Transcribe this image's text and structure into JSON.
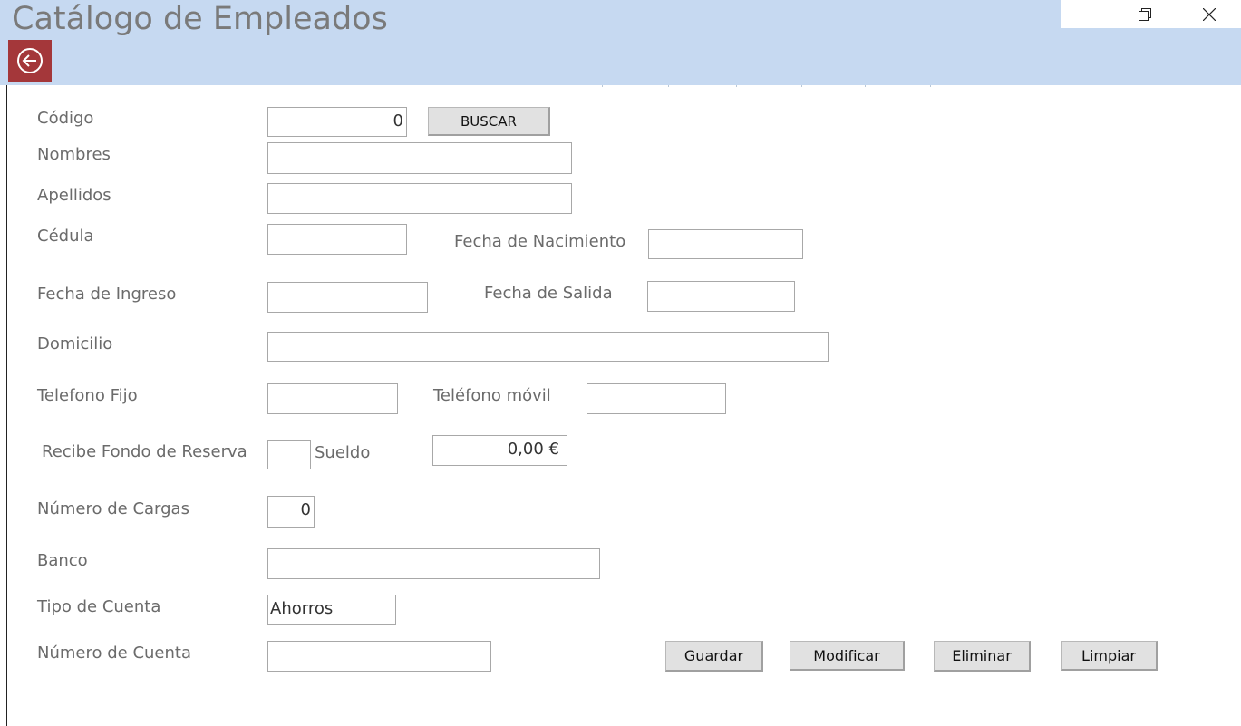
{
  "window": {
    "title": "Catálogo de Empleados",
    "controls": {
      "minimize_icon": "minimize-icon",
      "restore_icon": "restore-icon",
      "close_icon": "close-icon"
    },
    "colors": {
      "header_bg": "#c6d9f1",
      "back_button_bg": "#a4373a"
    }
  },
  "form": {
    "codigo": {
      "label": "Código",
      "value": "0",
      "search_button": "BUSCAR"
    },
    "nombres": {
      "label": "Nombres",
      "value": ""
    },
    "apellidos": {
      "label": "Apellidos",
      "value": ""
    },
    "cedula": {
      "label": "Cédula",
      "value": ""
    },
    "fecha_nacimiento": {
      "label": "Fecha de Nacimiento",
      "value": ""
    },
    "fecha_ingreso": {
      "label": "Fecha de Ingreso",
      "value": ""
    },
    "fecha_salida": {
      "label": "Fecha de Salida",
      "value": ""
    },
    "domicilio": {
      "label": "Domicilio",
      "value": ""
    },
    "telefono_fijo": {
      "label": "Telefono Fijo",
      "value": ""
    },
    "telefono_movil": {
      "label": "Teléfono móvil",
      "value": ""
    },
    "fondo_reserva": {
      "label": "Recibe Fondo de Reserva",
      "value": ""
    },
    "sueldo": {
      "label": "Sueldo",
      "value": "0,00 €"
    },
    "numero_cargas": {
      "label": "Número de Cargas",
      "value": "0"
    },
    "banco": {
      "label": "Banco",
      "value": ""
    },
    "tipo_cuenta": {
      "label": "Tipo de Cuenta",
      "value": "Ahorros"
    },
    "numero_cuenta": {
      "label": "Número de Cuenta",
      "value": ""
    }
  },
  "actions": {
    "guardar": "Guardar",
    "modificar": "Modificar",
    "eliminar": "Eliminar",
    "limpiar": "Limpiar"
  }
}
